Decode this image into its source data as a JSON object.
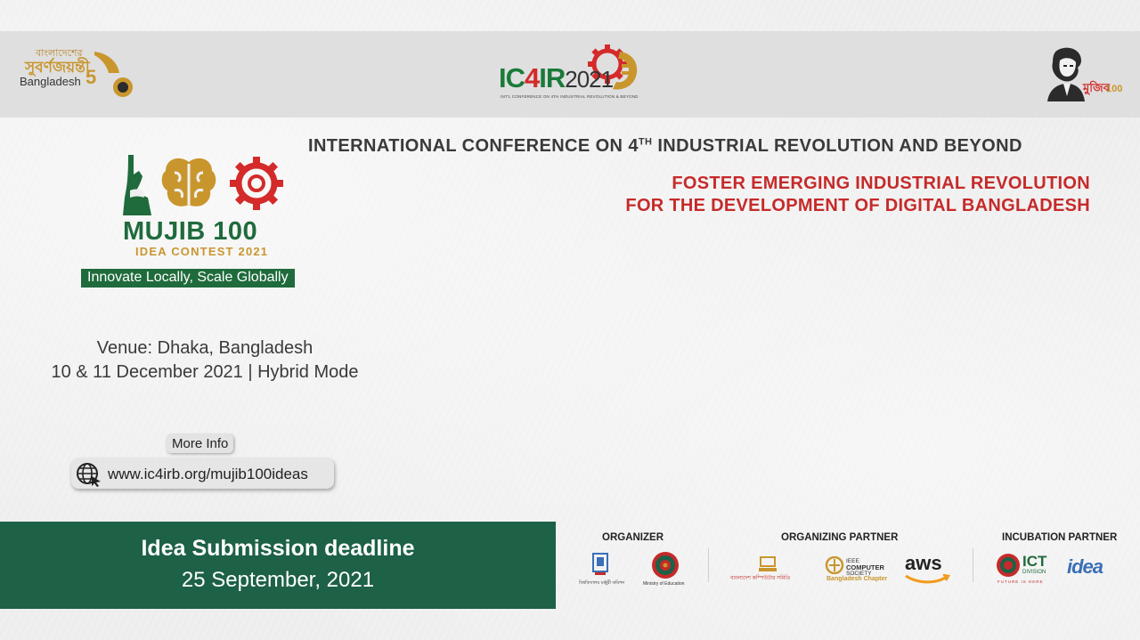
{
  "header": {
    "jubilee_bn_line1": "বাংলাদেশের",
    "jubilee_bn_line2": "সুবর্ণজয়ন্তী",
    "jubilee_country": "Bangladesh",
    "jubilee_number": "5",
    "ic4ir_ic": "IC",
    "ic4ir_four": "4",
    "ic4ir_ir": "IR",
    "ic4ir_year": "2021",
    "ic4ir_sub": "INT'L CONFERENCE ON 4TH INDUSTRIAL REVOLUTION & BEYOND",
    "mujib_bn": "মুজিব",
    "mujib_num": "100"
  },
  "main": {
    "conference_title_pre": "INTERNATIONAL CONFERENCE ON 4",
    "conference_title_sup": "TH",
    "conference_title_post": " INDUSTRIAL REVOLUTION AND BEYOND",
    "tagline_line1": "FOSTER EMERGING INDUSTRIAL REVOLUTION",
    "tagline_line2": "FOR THE DEVELOPMENT OF DIGITAL BANGLADESH"
  },
  "contest": {
    "title": "MUJIB 100",
    "subtitle": "IDEA CONTEST 2021",
    "slogan": "Innovate Locally, Scale Globally"
  },
  "event": {
    "venue": "Venue: Dhaka, Bangladesh",
    "dates": "10 & 11 December 2021  | Hybrid Mode"
  },
  "links": {
    "more_info": "More Info",
    "url": "www.ic4irb.org/mujib100ideas"
  },
  "deadline": {
    "label": "Idea Submission deadline",
    "date": "25 September, 2021"
  },
  "partners": {
    "organizer_label": "ORGANIZER",
    "organizing_partner_label": "ORGANIZING PARTNER",
    "incubation_partner_label": "INCUBATION PARTNER",
    "ugc_caption": "বিশ্ববিদ্যালয় মঞ্জুরী কমিশন",
    "moe_caption": "Ministry of Education",
    "bcs_caption": "বাংলাদেশ কম্পিউটার সমিতি",
    "ieee_text_line1": "IEEE",
    "ieee_text_line2": "COMPUTER",
    "ieee_text_line3": "SOCIETY",
    "ieee_chapter": "Bangladesh Chapter",
    "aws": "aws",
    "ict": "ICT",
    "ict_division": "DIVISION",
    "ict_footer": "FUTURE IS HERE",
    "idea": "idea"
  },
  "colors": {
    "green": "#1d6147",
    "red": "#c62a2a",
    "gold": "#c9962e",
    "dark_text": "#3a3a3a"
  }
}
